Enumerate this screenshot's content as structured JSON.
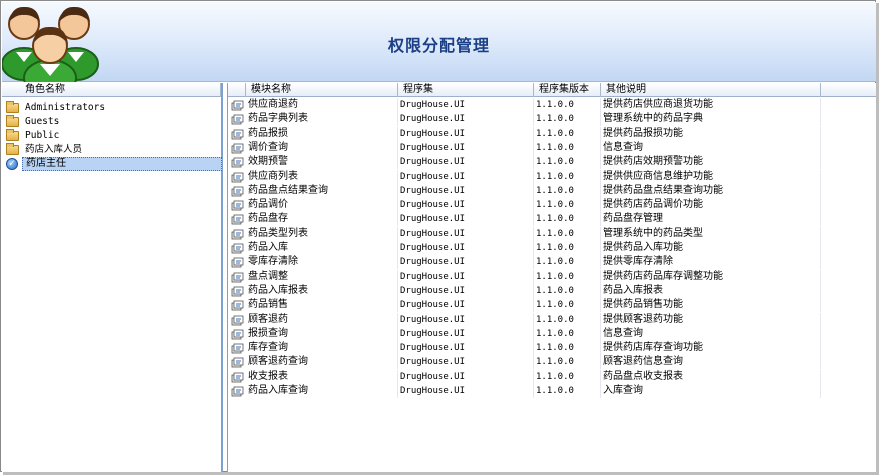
{
  "header": {
    "title": "权限分配管理",
    "accent": "#1a3f86"
  },
  "roles": {
    "column": "角色名称",
    "items": [
      {
        "label": "Administrators",
        "icon": "folder-icon",
        "selected": false
      },
      {
        "label": "Guests",
        "icon": "folder-icon",
        "selected": false
      },
      {
        "label": "Public",
        "icon": "folder-icon",
        "selected": false
      },
      {
        "label": "药店入库人员",
        "icon": "folder-icon",
        "selected": false
      },
      {
        "label": "药店主任",
        "icon": "check-icon",
        "selected": true
      }
    ]
  },
  "modules": {
    "columns": [
      "模块名称",
      "程序集",
      "程序集版本",
      "其他说明"
    ],
    "rows": [
      [
        "供应商退药",
        "DrugHouse.UI",
        "1.1.0.0",
        "提供药店供应商退货功能"
      ],
      [
        "药品字典列表",
        "DrugHouse.UI",
        "1.1.0.0",
        "管理系统中的药品字典"
      ],
      [
        "药品报损",
        "DrugHouse.UI",
        "1.1.0.0",
        "提供药品报损功能"
      ],
      [
        "调价查询",
        "DrugHouse.UI",
        "1.1.0.0",
        "信息查询"
      ],
      [
        "效期预警",
        "DrugHouse.UI",
        "1.1.0.0",
        "提供药店效期预警功能"
      ],
      [
        "供应商列表",
        "DrugHouse.UI",
        "1.1.0.0",
        "提供供应商信息维护功能"
      ],
      [
        "药品盘点结果查询",
        "DrugHouse.UI",
        "1.1.0.0",
        "提供药品盘点结果查询功能"
      ],
      [
        "药品调价",
        "DrugHouse.UI",
        "1.1.0.0",
        "提供药店药品调价功能"
      ],
      [
        "药品盘存",
        "DrugHouse.UI",
        "1.1.0.0",
        "药品盘存管理"
      ],
      [
        "药品类型列表",
        "DrugHouse.UI",
        "1.1.0.0",
        "管理系统中的药品类型"
      ],
      [
        "药品入库",
        "DrugHouse.UI",
        "1.1.0.0",
        "提供药品入库功能"
      ],
      [
        "零库存清除",
        "DrugHouse.UI",
        "1.1.0.0",
        "提供零库存清除"
      ],
      [
        "盘点调整",
        "DrugHouse.UI",
        "1.1.0.0",
        "提供药店药品库存调整功能"
      ],
      [
        "药品入库报表",
        "DrugHouse.UI",
        "1.1.0.0",
        "药品入库报表"
      ],
      [
        "药品销售",
        "DrugHouse.UI",
        "1.1.0.0",
        "提供药品销售功能"
      ],
      [
        "顾客退药",
        "DrugHouse.UI",
        "1.1.0.0",
        "提供顾客退药功能"
      ],
      [
        "报损查询",
        "DrugHouse.UI",
        "1.1.0.0",
        "信息查询"
      ],
      [
        "库存查询",
        "DrugHouse.UI",
        "1.1.0.0",
        "提供药店库存查询功能"
      ],
      [
        "顾客退药查询",
        "DrugHouse.UI",
        "1.1.0.0",
        "顾客退药信息查询"
      ],
      [
        "收支报表",
        "DrugHouse.UI",
        "1.1.0.0",
        "药品盘点收支报表"
      ],
      [
        "药品入库查询",
        "DrugHouse.UI",
        "1.1.0.0",
        "入库查询"
      ]
    ]
  }
}
